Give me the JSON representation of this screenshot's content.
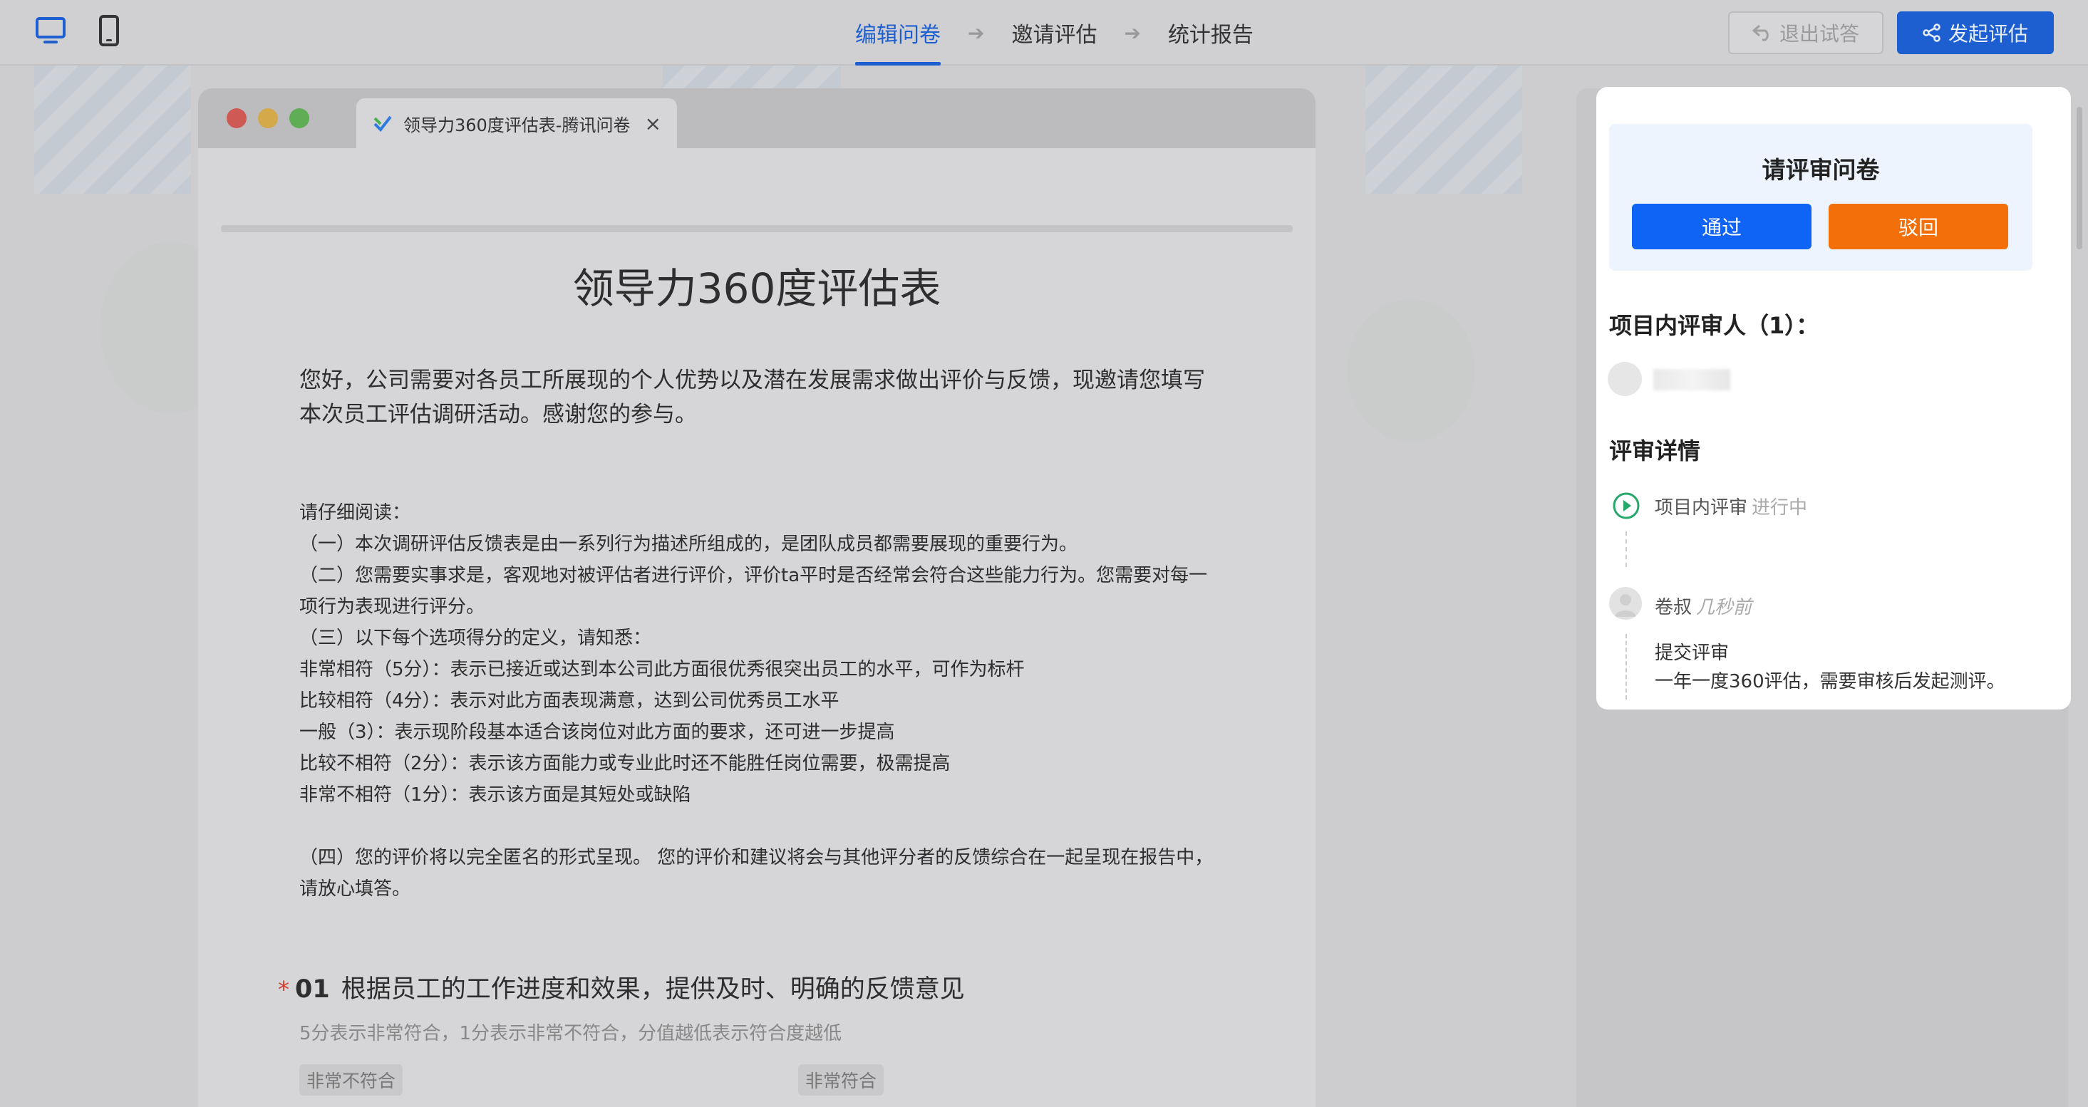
{
  "topbar": {
    "device_icons": [
      "desktop-icon",
      "mobile-icon"
    ],
    "steps": [
      {
        "label": "编辑问卷",
        "active": true
      },
      {
        "label": "邀请评估",
        "active": false
      },
      {
        "label": "统计报告",
        "active": false
      }
    ],
    "exit_trial_label": "退出试答",
    "launch_label": "发起评估",
    "accent_color": "#1d5fd0"
  },
  "browser": {
    "tab_title": "领导力360度评估表-腾讯问卷",
    "tab_close": "×"
  },
  "survey": {
    "title": "领导力360度评估表",
    "intro": "您好，公司需要对各员工所展现的个人优势以及潜在发展需求做出评价与反馈，现邀请您填写本次员工评估调研活动。感谢您的参与。",
    "notes": [
      "请仔细阅读：",
      "（一）本次调研评估反馈表是由一系列行为描述所组成的，是团队成员都需要展现的重要行为。",
      "（二）您需要实事求是，客观地对被评估者进行评价，评价ta平时是否经常会符合这些能力行为。您需要对每一项行为表现进行评分。",
      "（三）以下每个选项得分的定义，请知悉：",
      "非常相符（5分）：表示已接近或达到本公司此方面很优秀很突出员工的水平，可作为标杆",
      "比较相符（4分）：表示对此方面表现满意，达到公司优秀员工水平",
      "一般（3）：表示现阶段基本适合该岗位对此方面的要求，还可进一步提高",
      "比较不相符（2分）：表示该方面能力或专业此时还不能胜任岗位需要，极需提高",
      "非常不相符（1分）：表示该方面是其短处或缺陷"
    ],
    "notes_final": "（四）您的评价将以完全匿名的形式呈现。 您的评价和建议将会与其他评分者的反馈综合在一起呈现在报告中，请放心填答。",
    "question": {
      "required_mark": "*",
      "number": "01",
      "text": "根据员工的工作进度和效果，提供及时、明确的反馈意见",
      "description": "5分表示非常符合，1分表示非常不符合，分值越低表示符合度越低",
      "scale_low": "非常不符合",
      "scale_high": "非常符合"
    }
  },
  "review_panel": {
    "title": "请评审问卷",
    "pass_label": "通过",
    "reject_label": "驳回",
    "pass_color": "#0f63f5",
    "reject_color": "#f36f0a",
    "reviewers_heading": "项目内评审人（1）：",
    "details_heading": "评审详情",
    "timeline": {
      "stage": "项目内评审",
      "stage_status": "进行中",
      "author": "卷叔",
      "time": "几秒前",
      "action": "提交评审",
      "comment": "一年一度360评估，需要审核后发起测评。"
    }
  }
}
